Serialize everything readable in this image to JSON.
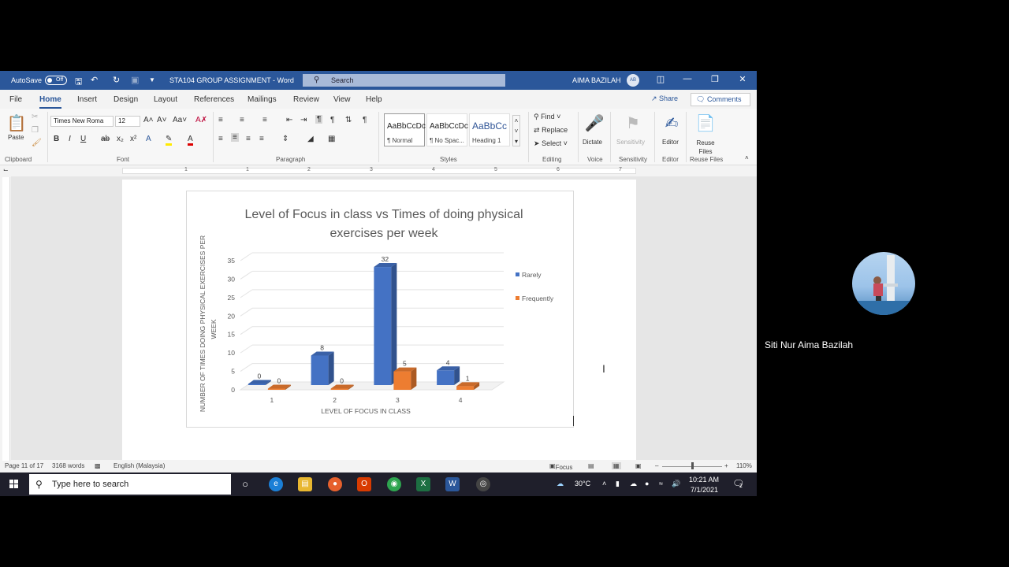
{
  "window": {
    "autosave_label": "AutoSave",
    "autosave_state": "Off",
    "doc_title": "STA104 GROUP ASSIGNMENT  -  Word",
    "search_placeholder": "Search",
    "user_name": "AIMA BAZILAH",
    "user_initials": "AB"
  },
  "menu_tabs": [
    "File",
    "Home",
    "Insert",
    "Design",
    "Layout",
    "References",
    "Mailings",
    "Review",
    "View",
    "Help"
  ],
  "share_label": "Share",
  "comments_label": "Comments",
  "ribbon": {
    "paste_label": "Paste",
    "font_name": "Times New Roma",
    "font_size": "12",
    "styles": [
      {
        "preview": "AaBbCcDc",
        "name": "¶ Normal"
      },
      {
        "preview": "AaBbCcDc",
        "name": "¶ No Spac..."
      },
      {
        "preview": "AaBbCc",
        "name": "Heading 1"
      }
    ],
    "find_label": "Find",
    "replace_label": "Replace",
    "select_label": "Select",
    "dictate_label": "Dictate",
    "sensitivity_label": "Sensitivity",
    "editor_label": "Editor",
    "reuse_label": "Reuse Files",
    "groups": [
      "Clipboard",
      "Font",
      "Paragraph",
      "Styles",
      "Editing",
      "Voice",
      "Sensitivity",
      "Editor",
      "Reuse Files"
    ]
  },
  "ruler_numbers": [
    "1",
    "1",
    "2",
    "3",
    "4",
    "5",
    "6",
    "7"
  ],
  "chart_data": {
    "type": "bar",
    "title": "Level of Focus in class vs Times of doing physical exercises per week",
    "xlabel": "LEVEL OF FOCUS IN CLASS",
    "ylabel": "NUMBER OF TIMES DOING PHYSICAL EXERCISES PER WEEK",
    "categories": [
      "1",
      "2",
      "3",
      "4"
    ],
    "series": [
      {
        "name": "Rarely",
        "values": [
          0,
          8,
          32,
          4
        ],
        "color": "#4472c4"
      },
      {
        "name": "Frequently",
        "values": [
          0,
          0,
          5,
          1
        ],
        "color": "#ed7d31"
      }
    ],
    "ylim": [
      0,
      35
    ],
    "yticks": [
      0,
      5,
      10,
      15,
      20,
      25,
      30,
      35
    ],
    "grid": true,
    "legend": "right",
    "style": "3D clustered column"
  },
  "status": {
    "page": "Page 11 of 17",
    "words": "3168 words",
    "language": "English (Malaysia)",
    "focus": "Focus",
    "zoom": "110%"
  },
  "taskbar": {
    "search_placeholder": "Type here to search",
    "temperature": "30°C",
    "time": "10:21 AM",
    "date": "7/1/2021",
    "notifications": "2"
  },
  "participant": {
    "name": "Siti Nur Aima Bazilah"
  }
}
